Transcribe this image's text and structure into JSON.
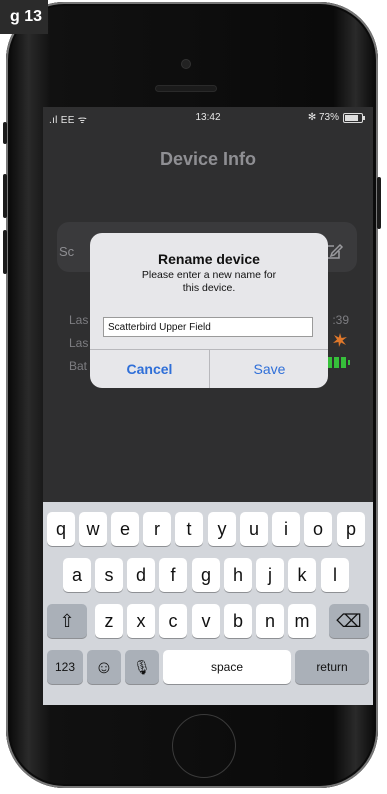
{
  "figure_tag": "g 13",
  "status_bar": {
    "carrier": ".ıl EE ᯤ",
    "time": "13:42",
    "battery": "✻ 73%"
  },
  "nav": {
    "title": "Device Info"
  },
  "background": {
    "card_label": "Sc",
    "rows": [
      {
        "label": "Las",
        "value": ":39"
      },
      {
        "label": "Las",
        "value": ""
      },
      {
        "label": "Bat",
        "value": ""
      }
    ]
  },
  "dialog": {
    "title": "Rename device",
    "message_line1": "Please enter a new name for",
    "message_line2": "this device.",
    "input_value": "Scatterbird Upper Field",
    "cancel_label": "Cancel",
    "save_label": "Save"
  },
  "keyboard": {
    "row1": [
      "q",
      "w",
      "e",
      "r",
      "t",
      "y",
      "u",
      "i",
      "o",
      "p"
    ],
    "row2": [
      "a",
      "s",
      "d",
      "f",
      "g",
      "h",
      "j",
      "k",
      "l"
    ],
    "row3": [
      "z",
      "x",
      "c",
      "v",
      "b",
      "n",
      "m"
    ],
    "shift_glyph": "⇧",
    "delete_glyph": "⌫",
    "numbers_label": "123",
    "emoji_glyph": "☺",
    "mic_glyph": "🎙",
    "space_label": "space",
    "return_label": "return"
  },
  "colors": {
    "accent": "#2f6fd8",
    "battery_green": "#36c03a",
    "screen_bg": "#2f2f30"
  }
}
